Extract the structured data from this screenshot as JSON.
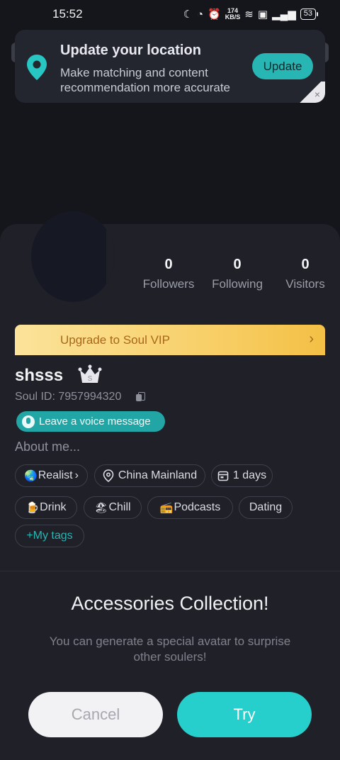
{
  "status_bar": {
    "time": "15:52",
    "speed_value": "174",
    "speed_unit": "KB/S",
    "battery": "53"
  },
  "banner": {
    "title": "Update your location",
    "description": "Make matching and content recommendation more accurate",
    "button_label": "Update",
    "close_label": "×"
  },
  "profile": {
    "stats": [
      {
        "value": "0",
        "label": "Followers"
      },
      {
        "value": "0",
        "label": "Following"
      },
      {
        "value": "0",
        "label": "Visitors"
      }
    ],
    "vip_label": "Upgrade to Soul VIP",
    "vip_chevron": "›",
    "username": "shsss",
    "soul_id": "Soul ID: 7957994320",
    "voice_label": "Leave a voice message",
    "about": "About me...",
    "info_chips": [
      {
        "emoji": "🌏",
        "label": "Realist",
        "suffix": "›"
      },
      {
        "label": "China Mainland"
      },
      {
        "label": "1 days"
      }
    ],
    "tags": [
      {
        "emoji": "🍺",
        "label": "Drink"
      },
      {
        "emoji": "🏖",
        "label": "Chill"
      },
      {
        "emoji": "📻",
        "label": "Podcasts"
      },
      {
        "label": "Dating"
      }
    ],
    "my_tags": "+My tags"
  },
  "sheet": {
    "title": "Accessories Collection!",
    "description": "You can generate a special avatar to surprise other soulers!",
    "cancel_label": "Cancel",
    "try_label": "Try"
  },
  "colors": {
    "accent": "#27b6b4",
    "vip_gold": "#f8d06a",
    "background": "#15161c"
  }
}
